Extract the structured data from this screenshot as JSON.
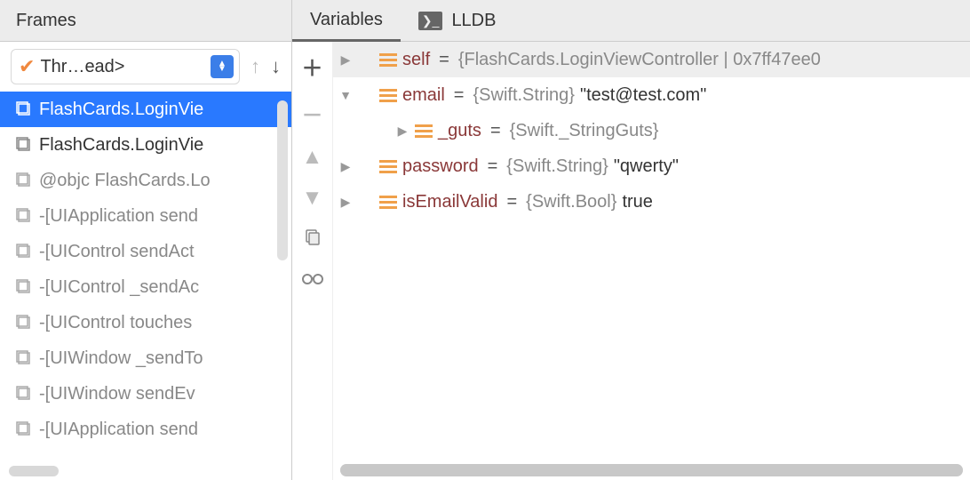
{
  "frames_header": "Frames",
  "thread_label": "Thr…ead>",
  "frames": [
    {
      "label": "FlashCards.LoginVie",
      "selected": true,
      "grey": false
    },
    {
      "label": "FlashCards.LoginVie",
      "selected": false,
      "grey": false
    },
    {
      "label": "@objc FlashCards.Lo",
      "selected": false,
      "grey": true
    },
    {
      "label": "-[UIApplication send",
      "selected": false,
      "grey": true
    },
    {
      "label": "-[UIControl sendAct",
      "selected": false,
      "grey": true
    },
    {
      "label": "-[UIControl _sendAc",
      "selected": false,
      "grey": true
    },
    {
      "label": "-[UIControl touches",
      "selected": false,
      "grey": true
    },
    {
      "label": "-[UIWindow _sendTo",
      "selected": false,
      "grey": true
    },
    {
      "label": "-[UIWindow sendEv",
      "selected": false,
      "grey": true
    },
    {
      "label": "-[UIApplication send",
      "selected": false,
      "grey": true
    }
  ],
  "tabs": {
    "variables": "Variables",
    "lldb": "LLDB",
    "terminal_badge": "❯_"
  },
  "variables": {
    "self": {
      "name": "self",
      "type": "{FlashCards.LoginViewController | 0x7ff47ee0"
    },
    "email": {
      "name": "email",
      "type": "{Swift.String}",
      "value": "\"test@test.com\""
    },
    "guts": {
      "name": "_guts",
      "type": "{Swift._StringGuts}"
    },
    "password": {
      "name": "password",
      "type": "{Swift.String}",
      "value": "\"qwerty\""
    },
    "isEmailValid": {
      "name": "isEmailValid",
      "type": "{Swift.Bool}",
      "value": "true"
    }
  }
}
